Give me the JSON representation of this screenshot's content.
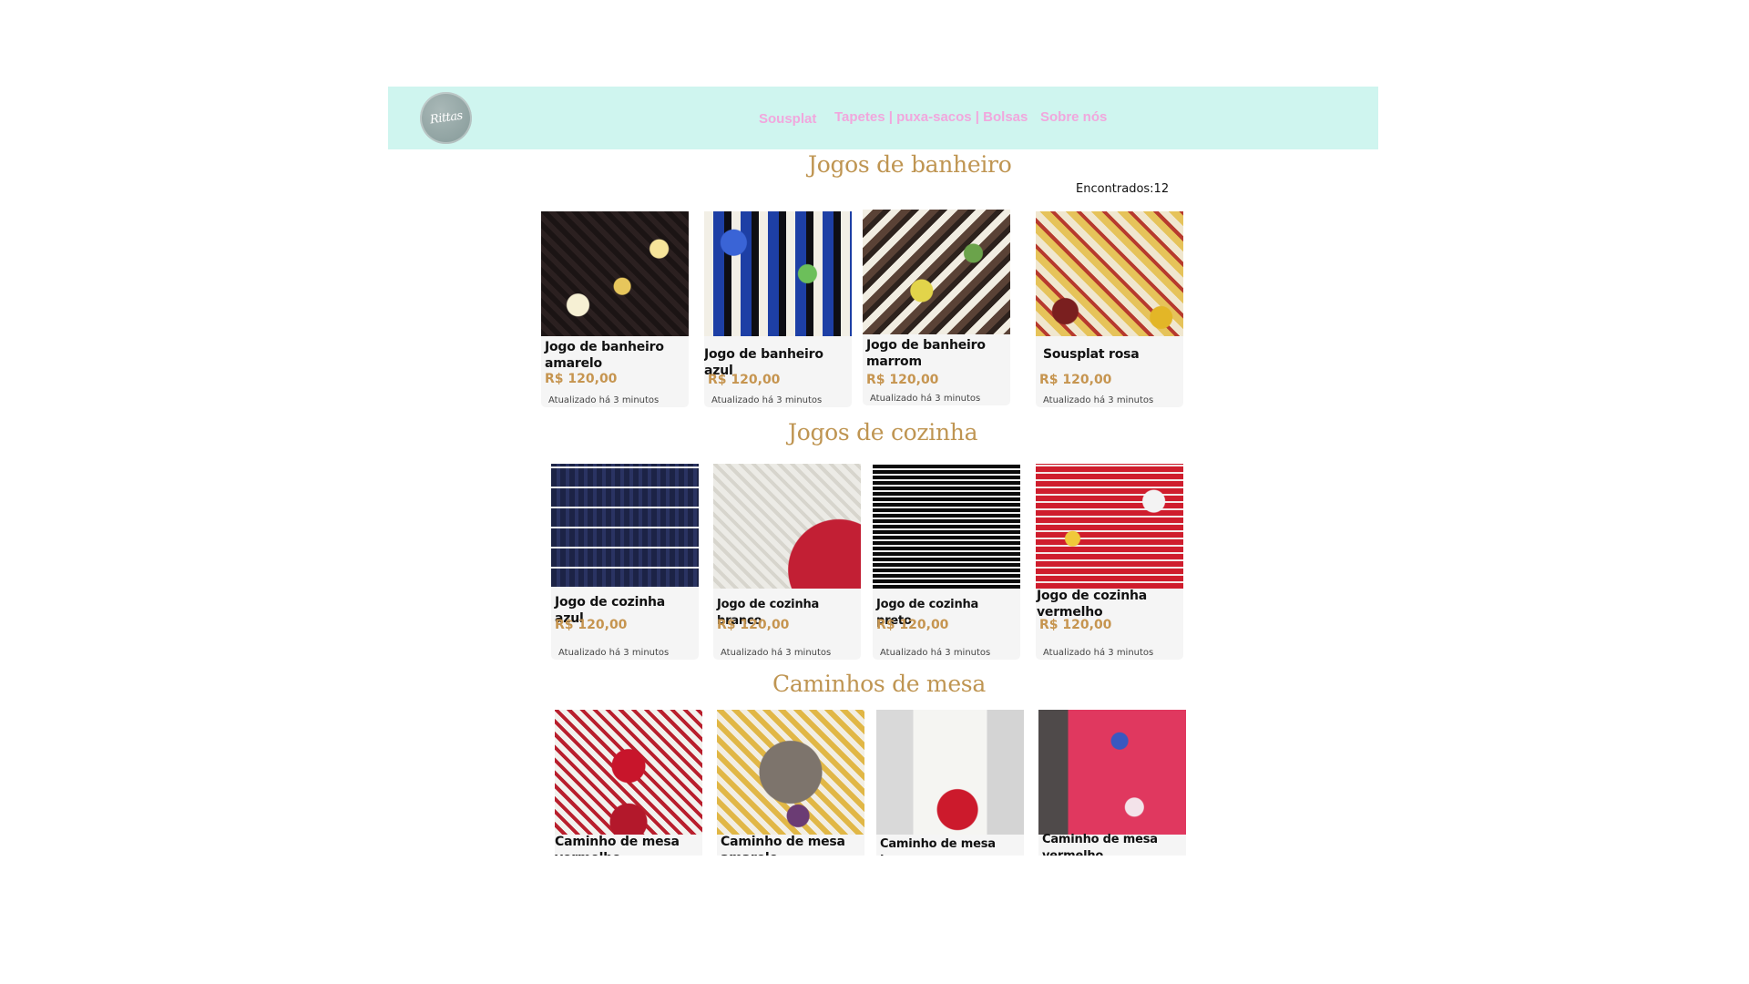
{
  "header": {
    "logo_text": "Rittas",
    "nav": [
      {
        "label": "Sousplat"
      },
      {
        "label": "Tapetes | puxa-sacos | Bolsas"
      },
      {
        "label": "Sobre nós"
      }
    ],
    "background_color": "#cff5ef",
    "nav_color": "#f1a7dd"
  },
  "sections": [
    {
      "title": "Jogos de banheiro",
      "found": "Encontrados:12",
      "products": [
        {
          "name": "Jogo de banheiro amarelo",
          "price": "R$ 120,00",
          "updated": "Atualizado há 3 minutos"
        },
        {
          "name": "Jogo de banheiro azul",
          "price": "R$ 120,00",
          "updated": "Atualizado há 3 minutos"
        },
        {
          "name": "Jogo de banheiro marrom",
          "price": "R$ 120,00",
          "updated": "Atualizado há 3 minutos"
        },
        {
          "name": "Sousplat rosa",
          "price": "R$ 120,00",
          "updated": "Atualizado há 3 minutos"
        }
      ]
    },
    {
      "title": "Jogos de cozinha",
      "products": [
        {
          "name": "Jogo de cozinha azul",
          "price": "R$ 120,00",
          "updated": "Atualizado há 3 minutos"
        },
        {
          "name": "Jogo de cozinha branco",
          "price": "R$ 120,00",
          "updated": "Atualizado há 3 minutos"
        },
        {
          "name": "Jogo de cozinha preto",
          "price": "R$ 120,00",
          "updated": "Atualizado há 3 minutos"
        },
        {
          "name": "Jogo de cozinha vermelho",
          "price": "R$ 120,00",
          "updated": "Atualizado há 3 minutos"
        }
      ]
    },
    {
      "title": "Caminhos de mesa",
      "products": [
        {
          "name": "Caminho de mesa vermelho"
        },
        {
          "name": "Caminho de mesa amarelo"
        },
        {
          "name": "Caminho de mesa branco"
        },
        {
          "name": "Caminho de mesa vermelho"
        }
      ]
    }
  ],
  "colors": {
    "section_title": "#bf9552",
    "price": "#c69550"
  }
}
